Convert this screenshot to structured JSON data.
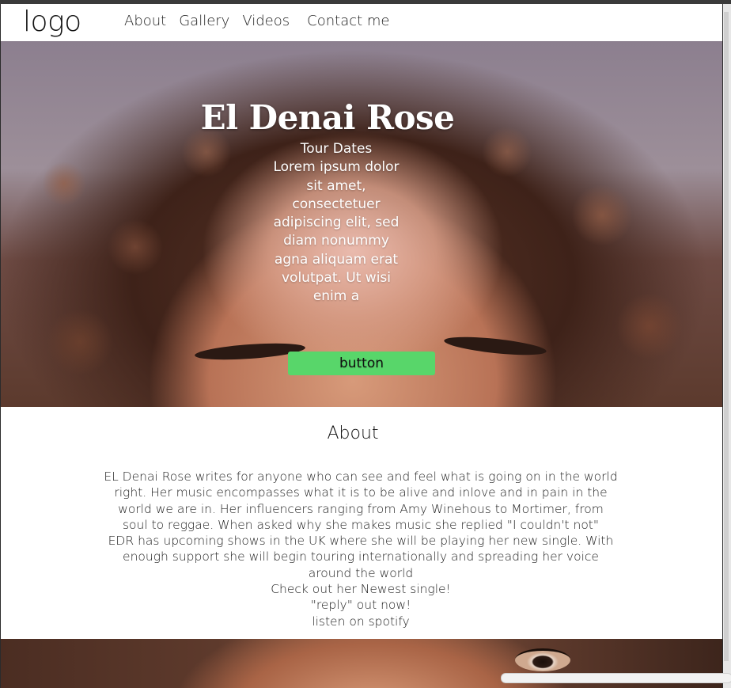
{
  "nav": {
    "logo": "logo",
    "links": [
      "About",
      "Gallery",
      "Videos",
      "Contact me"
    ]
  },
  "hero": {
    "title": "El Denai Rose",
    "subtitle": "Tour Dates",
    "text": "Lorem ipsum dolor sit amet, consectetuer adipiscing elit, sed diam nonummy agna aliquam erat volutpat. Ut wisi enim a",
    "button": "button",
    "button_color": "#58d66a"
  },
  "about": {
    "title": "About",
    "paragraphs": [
      "EL Denai Rose writes for anyone who can see and feel what is going on in the world right. Her music encompasses what it is to be alive and inlove and in pain in the world we are in. Her influencers ranging from Amy Winehous to Mortimer, from soul to reggae. When asked why she makes music she replied \"I couldn't not\"",
      "EDR has upcoming shows in the UK where she will be playing her new single. With enough support she will begin touring internationally and spreading her voice around the world",
      "Check out her Newest single!",
      "\"reply\" out now!",
      "listen on spotify"
    ]
  }
}
